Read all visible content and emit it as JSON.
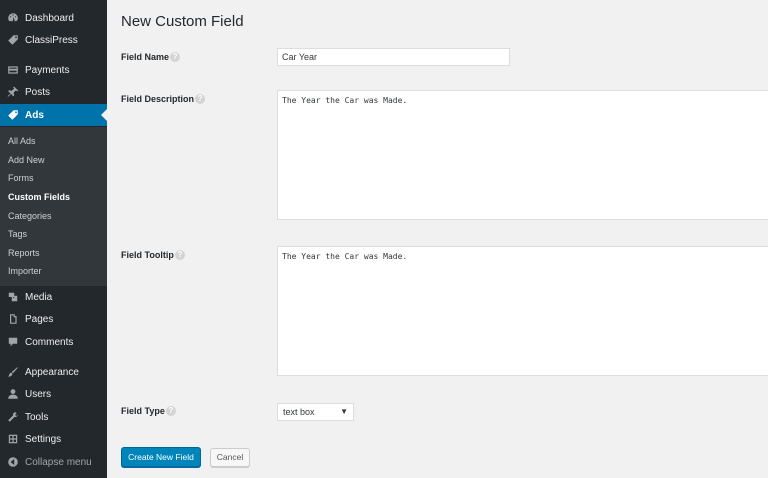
{
  "sidebar": {
    "top_items": [
      {
        "label": "Dashboard",
        "icon": "dashboard-icon"
      },
      {
        "label": "ClassiPress",
        "icon": "tag-icon"
      },
      {
        "label": "Payments",
        "icon": "card-icon"
      },
      {
        "label": "Posts",
        "icon": "pin-icon"
      },
      {
        "label": "Ads",
        "icon": "tag-icon"
      }
    ],
    "submenu": [
      "All Ads",
      "Add New",
      "Forms",
      "Custom Fields",
      "Categories",
      "Tags",
      "Reports",
      "Importer"
    ],
    "bottom_items": [
      {
        "label": "Media",
        "icon": "media-icon"
      },
      {
        "label": "Pages",
        "icon": "pages-icon"
      },
      {
        "label": "Comments",
        "icon": "comment-icon"
      },
      {
        "label": "Appearance",
        "icon": "brush-icon"
      },
      {
        "label": "Users",
        "icon": "users-icon"
      },
      {
        "label": "Tools",
        "icon": "wrench-icon"
      },
      {
        "label": "Settings",
        "icon": "settings-icon"
      },
      {
        "label": "Collapse menu",
        "icon": "collapse-icon"
      }
    ],
    "active_color": "#0073aa",
    "background_color": "#23282d"
  },
  "main": {
    "title": "New Custom Field",
    "help_glyph": "?",
    "field_name": {
      "label": "Field Name",
      "value": "Car Year"
    },
    "field_description": {
      "label": "Field Description",
      "value": "The Year the Car was Made."
    },
    "field_tooltip": {
      "label": "Field Tooltip",
      "value": "The Year the Car was Made."
    },
    "field_type": {
      "label": "Field Type",
      "value": "text box",
      "caret": "▼"
    },
    "buttons": {
      "create": "Create New Field",
      "cancel": "Cancel"
    }
  }
}
